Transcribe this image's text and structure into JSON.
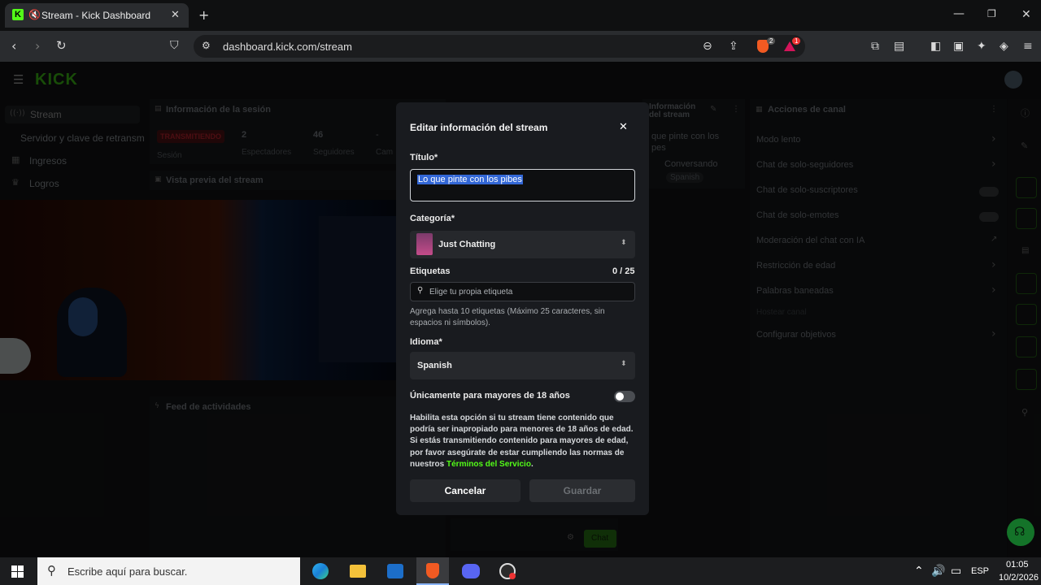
{
  "browser": {
    "tab_title": "Stream - Kick Dashboard",
    "url": "dashboard.kick.com/stream",
    "badge_brave": "2",
    "badge_alert": "1"
  },
  "header": {
    "logo": "KICK"
  },
  "sidebar": {
    "items": [
      {
        "label": "Stream"
      },
      {
        "label": "Servidor y clave de retransm"
      },
      {
        "label": "Ingresos"
      },
      {
        "label": "Logros"
      }
    ]
  },
  "session": {
    "title": "Información de la sesión",
    "status": "TRANSMITIENDO",
    "status_label": "Sesión",
    "viewers": "2",
    "viewers_label": "Espectadores",
    "followers": "46",
    "followers_label": "Seguidores",
    "third": "-",
    "third_label": "Cam"
  },
  "preview": {
    "title": "Vista previa del stream"
  },
  "activity": {
    "title": "Feed de actividades"
  },
  "stream_info_card": {
    "title_line1": "Información",
    "title_line2": "del stream",
    "stream_title": "que pinte con los",
    "stream_title2": "pes",
    "category": "Conversando",
    "language": "Spanish"
  },
  "channel_actions": {
    "title": "Acciones de canal",
    "items": [
      {
        "label": "Modo lento"
      },
      {
        "label": "Chat de solo-seguidores"
      },
      {
        "label": "Chat de solo-suscriptores"
      },
      {
        "label": "Chat de solo-emotes"
      },
      {
        "label": "Moderación del chat con IA"
      },
      {
        "label": "Restricción de edad"
      },
      {
        "label": "Palabras baneadas"
      },
      {
        "label": "Hostear canal"
      },
      {
        "label": "Configurar objetivos"
      }
    ]
  },
  "chat": {
    "button": "Chat"
  },
  "modal": {
    "title": "Editar información del stream",
    "title_label": "Título*",
    "title_value": "Lo que pinte con los pibes",
    "category_label": "Categoría*",
    "category_value": "Just Chatting",
    "tags_label": "Etiquetas",
    "tags_count": "0 / 25",
    "tags_placeholder": "Elige tu propia etiqueta",
    "tags_hint": "Agrega hasta 10 etiquetas (Máximo 25 caracteres, sin espacios ni símbolos).",
    "language_label": "Idioma*",
    "language_value": "Spanish",
    "mature_label": "Únicamente para mayores de 18 años",
    "mature_desc": "Habilita esta opción si tu stream tiene contenido que podría ser inapropiado para menores de 18 años de edad. Si estás transmitiendo contenido para mayores de edad, por favor asegúrate de estar cumpliendo las normas de nuestros",
    "mature_link": "Términos del Servicio",
    "mature_end": ".",
    "cancel": "Cancelar",
    "save": "Guardar"
  },
  "taskbar": {
    "search_placeholder": "Escribe aquí para buscar.",
    "lang": "ESP",
    "time": "01:05",
    "date": "10/2/2026"
  },
  "colors": {
    "accent": "#53fc18",
    "live": "#e01b2c"
  }
}
